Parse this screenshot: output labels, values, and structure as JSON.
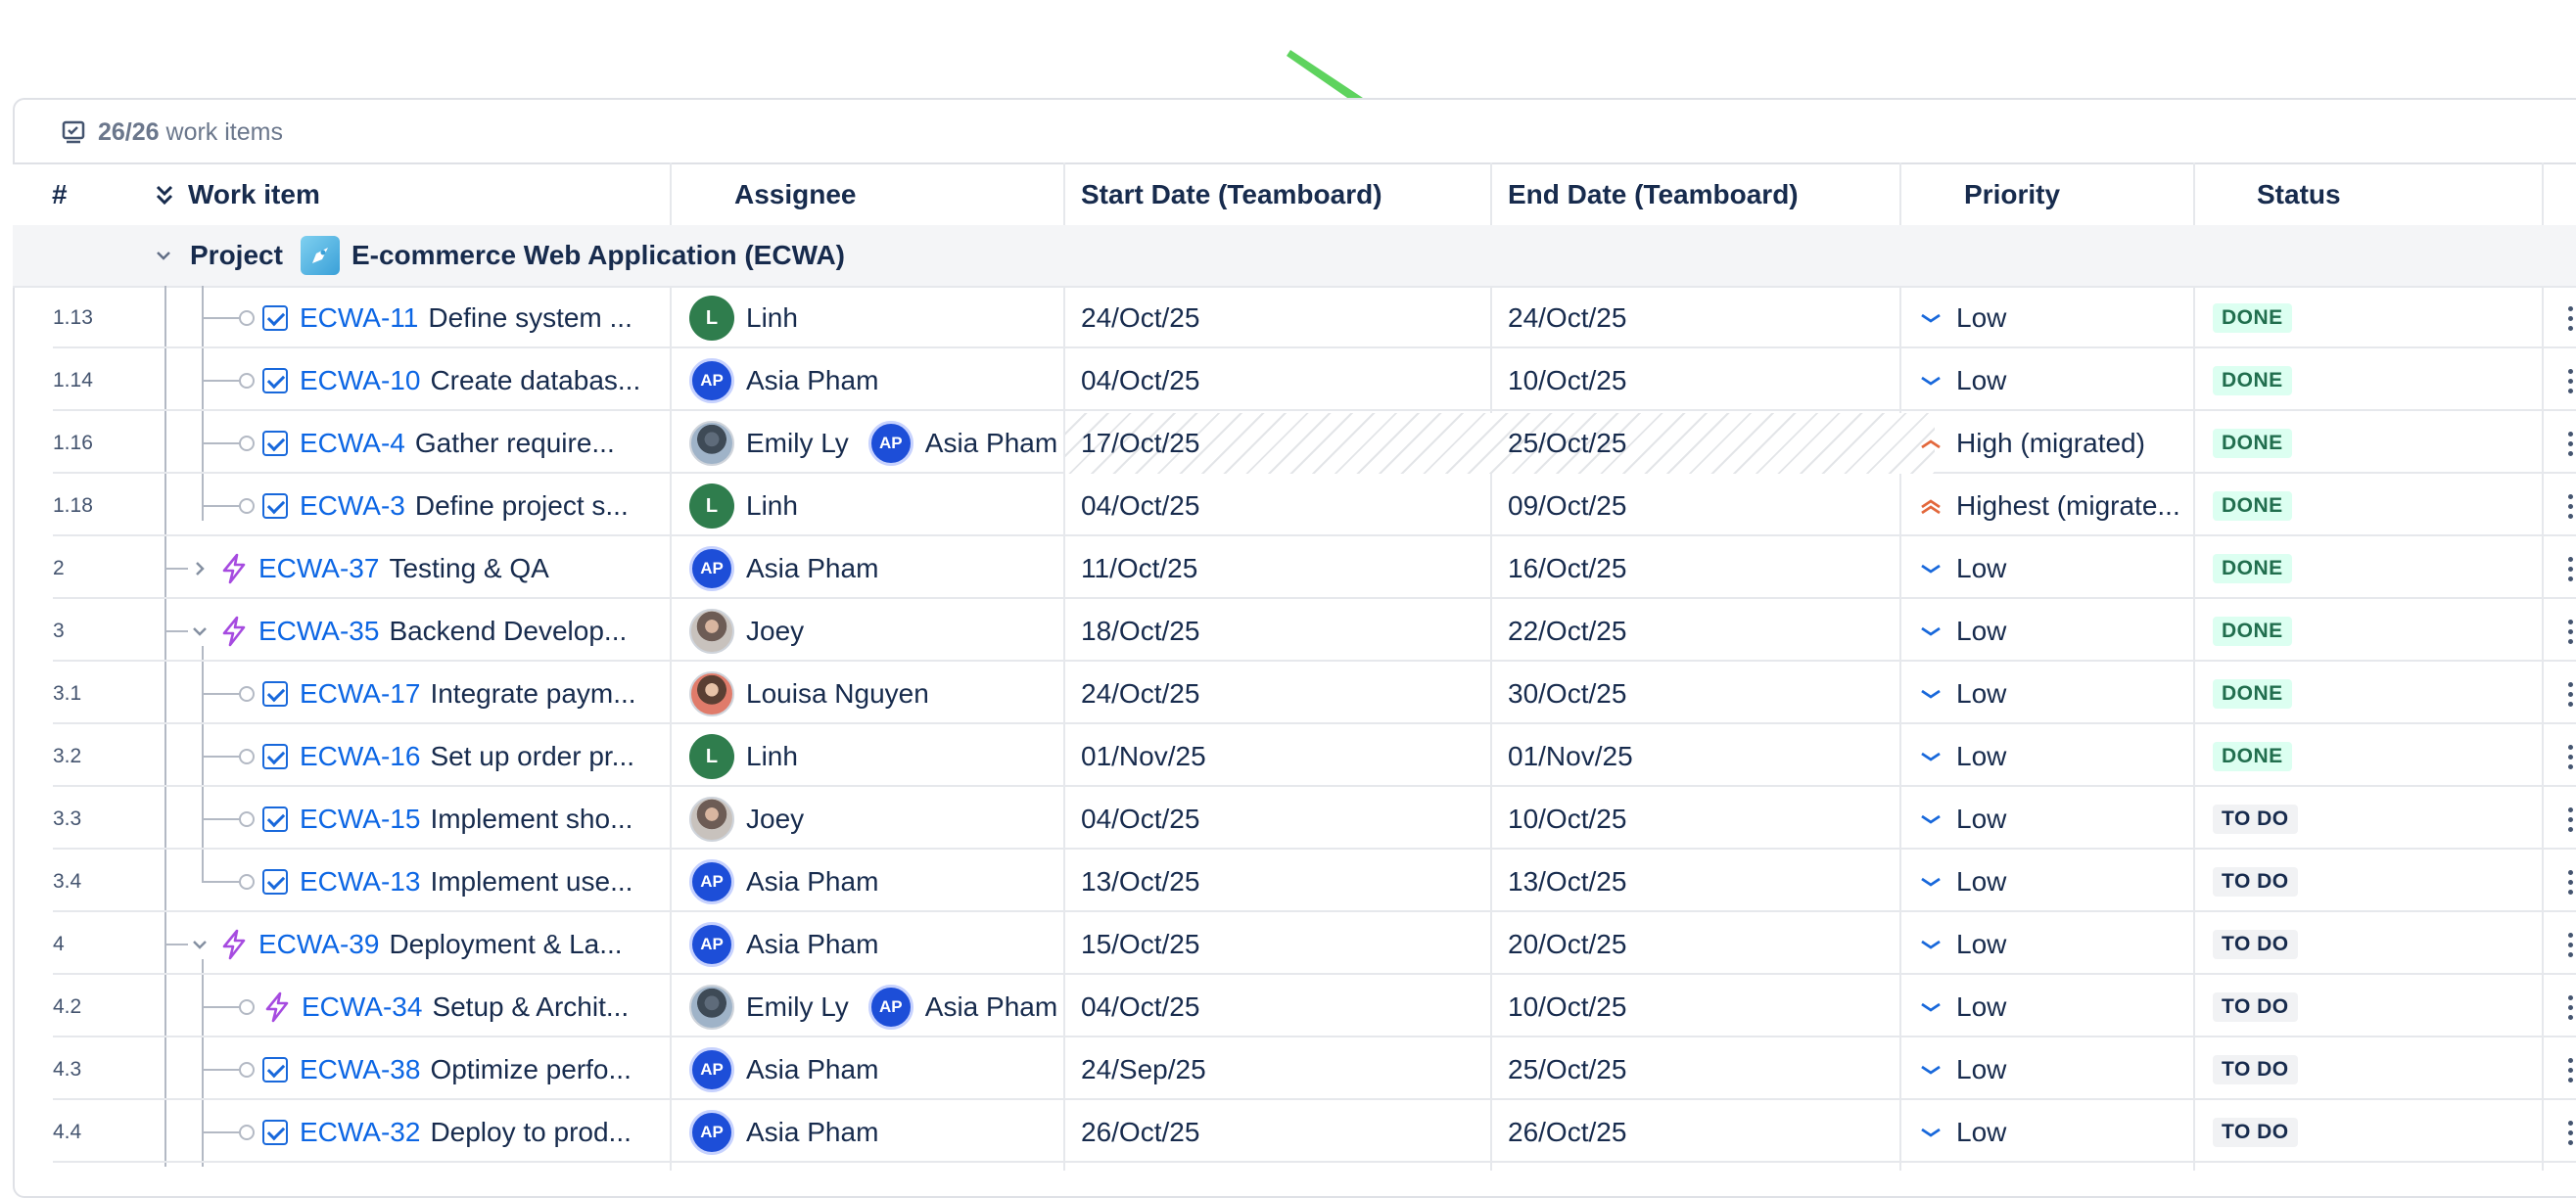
{
  "summary": {
    "count": "26/26",
    "label": "work items"
  },
  "columns": {
    "num": "#",
    "work_item": "Work item",
    "assignee": "Assignee",
    "start": "Start Date (Teamboard)",
    "end": "End Date (Teamboard)",
    "priority": "Priority",
    "status": "Status"
  },
  "group": {
    "label": "Project",
    "name": "E-commerce Web Application (ECWA)"
  },
  "rows": [
    {
      "num": "1.13",
      "key": "ECWA-11",
      "title": "Define system ...",
      "assignees": [
        {
          "initials": "L",
          "name": "Linh"
        }
      ],
      "start": "24/Oct/25",
      "end": "24/Oct/25",
      "priority": "Low",
      "status": "DONE"
    },
    {
      "num": "1.14",
      "key": "ECWA-10",
      "title": "Create databas...",
      "assignees": [
        {
          "initials": "AP",
          "name": "Asia Pham"
        }
      ],
      "start": "04/Oct/25",
      "end": "10/Oct/25",
      "priority": "Low",
      "status": "DONE"
    },
    {
      "num": "1.16",
      "key": "ECWA-4",
      "title": "Gather require...",
      "assignees": [
        {
          "initials": "",
          "name": "Emily Ly"
        },
        {
          "initials": "AP",
          "name": "Asia Pham"
        }
      ],
      "start": "17/Oct/25",
      "end": "25/Oct/25",
      "priority": "High (migrated)",
      "status": "DONE"
    },
    {
      "num": "1.18",
      "key": "ECWA-3",
      "title": "Define project s...",
      "assignees": [
        {
          "initials": "L",
          "name": "Linh"
        }
      ],
      "start": "04/Oct/25",
      "end": "09/Oct/25",
      "priority": "Highest (migrate...",
      "status": "DONE"
    },
    {
      "num": "2",
      "key": "ECWA-37",
      "title": "Testing & QA",
      "assignees": [
        {
          "initials": "AP",
          "name": "Asia Pham"
        }
      ],
      "start": "11/Oct/25",
      "end": "16/Oct/25",
      "priority": "Low",
      "status": "DONE"
    },
    {
      "num": "3",
      "key": "ECWA-35",
      "title": "Backend Develop...",
      "assignees": [
        {
          "initials": "",
          "name": "Joey"
        }
      ],
      "start": "18/Oct/25",
      "end": "22/Oct/25",
      "priority": "Low",
      "status": "DONE"
    },
    {
      "num": "3.1",
      "key": "ECWA-17",
      "title": "Integrate paym...",
      "assignees": [
        {
          "initials": "",
          "name": "Louisa Nguyen"
        }
      ],
      "start": "24/Oct/25",
      "end": "30/Oct/25",
      "priority": "Low",
      "status": "DONE"
    },
    {
      "num": "3.2",
      "key": "ECWA-16",
      "title": "Set up order pr...",
      "assignees": [
        {
          "initials": "L",
          "name": "Linh"
        }
      ],
      "start": "01/Nov/25",
      "end": "01/Nov/25",
      "priority": "Low",
      "status": "DONE"
    },
    {
      "num": "3.3",
      "key": "ECWA-15",
      "title": "Implement sho...",
      "assignees": [
        {
          "initials": "",
          "name": "Joey"
        }
      ],
      "start": "04/Oct/25",
      "end": "10/Oct/25",
      "priority": "Low",
      "status": "TO DO"
    },
    {
      "num": "3.4",
      "key": "ECWA-13",
      "title": "Implement use...",
      "assignees": [
        {
          "initials": "AP",
          "name": "Asia Pham"
        }
      ],
      "start": "13/Oct/25",
      "end": "13/Oct/25",
      "priority": "Low",
      "status": "TO DO"
    },
    {
      "num": "4",
      "key": "ECWA-39",
      "title": "Deployment & La...",
      "assignees": [
        {
          "initials": "AP",
          "name": "Asia Pham"
        }
      ],
      "start": "15/Oct/25",
      "end": "20/Oct/25",
      "priority": "Low",
      "status": "TO DO"
    },
    {
      "num": "4.2",
      "key": "ECWA-34",
      "title": "Setup & Archit...",
      "assignees": [
        {
          "initials": "",
          "name": "Emily Ly"
        },
        {
          "initials": "AP",
          "name": "Asia Pham"
        }
      ],
      "start": "04/Oct/25",
      "end": "10/Oct/25",
      "priority": "Low",
      "status": "TO DO"
    },
    {
      "num": "4.3",
      "key": "ECWA-38",
      "title": "Optimize perfo...",
      "assignees": [
        {
          "initials": "AP",
          "name": "Asia Pham"
        }
      ],
      "start": "24/Sep/25",
      "end": "25/Oct/25",
      "priority": "Low",
      "status": "TO DO"
    },
    {
      "num": "4.4",
      "key": "ECWA-32",
      "title": "Deploy to prod...",
      "assignees": [
        {
          "initials": "AP",
          "name": "Asia Pham"
        }
      ],
      "start": "26/Oct/25",
      "end": "26/Oct/25",
      "priority": "Low",
      "status": "TO DO"
    }
  ],
  "colors": {
    "accent_arrow": "#5ed35e",
    "link": "#0c66e4",
    "done_bg": "#dcfff1",
    "done_fg": "#216e4e"
  }
}
